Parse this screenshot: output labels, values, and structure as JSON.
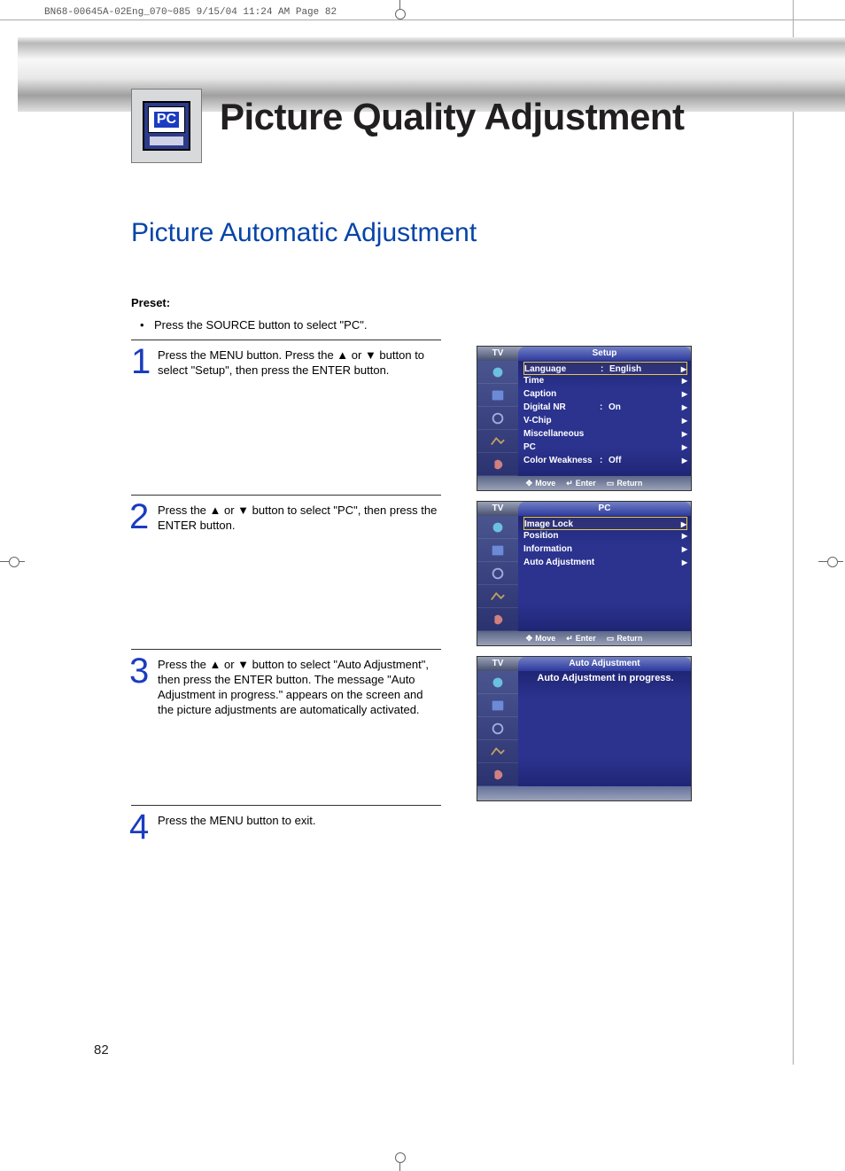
{
  "crop_header": "BN68-00645A-02Eng_070~085  9/15/04  11:24 AM  Page 82",
  "pc_badge": "PC",
  "main_title": "Picture Quality Adjustment",
  "section_title": "Picture Automatic Adjustment",
  "preset_label": "Preset:",
  "preset_text": "Press the SOURCE button to select \"PC\".",
  "steps": {
    "s1_num": "1",
    "s1_text": "Press the MENU button. Press the ▲ or ▼ button to select \"Setup\", then press the ENTER button.",
    "s2_num": "2",
    "s2_text": "Press the ▲ or ▼ button to select \"PC\", then press the ENTER button.",
    "s3_num": "3",
    "s3_text": "Press the ▲ or ▼ button to select \"Auto Adjustment\", then press the ENTER button. The message \"Auto Adjustment in progress.\" appears on the screen and the picture adjustments are automatically activated.",
    "s4_num": "4",
    "s4_text": "Press the MENU button to exit."
  },
  "osd1": {
    "tv": "TV",
    "title": "Setup",
    "rows": [
      {
        "k": "Language",
        "c": ":",
        "v": "English",
        "sel": true
      },
      {
        "k": "Time",
        "c": "",
        "v": "",
        "sel": false
      },
      {
        "k": "Caption",
        "c": "",
        "v": "",
        "sel": false
      },
      {
        "k": "Digital NR",
        "c": ":",
        "v": "On",
        "sel": false
      },
      {
        "k": "V-Chip",
        "c": "",
        "v": "",
        "sel": false
      },
      {
        "k": "Miscellaneous",
        "c": "",
        "v": "",
        "sel": false
      },
      {
        "k": "PC",
        "c": "",
        "v": "",
        "sel": false
      },
      {
        "k": "Color Weakness",
        "c": ":",
        "v": "Off",
        "sel": false
      }
    ],
    "foot_move": "Move",
    "foot_enter": "Enter",
    "foot_return": "Return"
  },
  "osd2": {
    "tv": "TV",
    "title": "PC",
    "rows": [
      {
        "k": "Image Lock",
        "sel": true
      },
      {
        "k": "Position",
        "sel": false
      },
      {
        "k": "Information",
        "sel": false
      },
      {
        "k": "Auto Adjustment",
        "sel": false
      }
    ],
    "foot_move": "Move",
    "foot_enter": "Enter",
    "foot_return": "Return"
  },
  "osd3": {
    "tv": "TV",
    "title": "Auto Adjustment",
    "message": "Auto Adjustment in progress."
  },
  "page_number": "82"
}
